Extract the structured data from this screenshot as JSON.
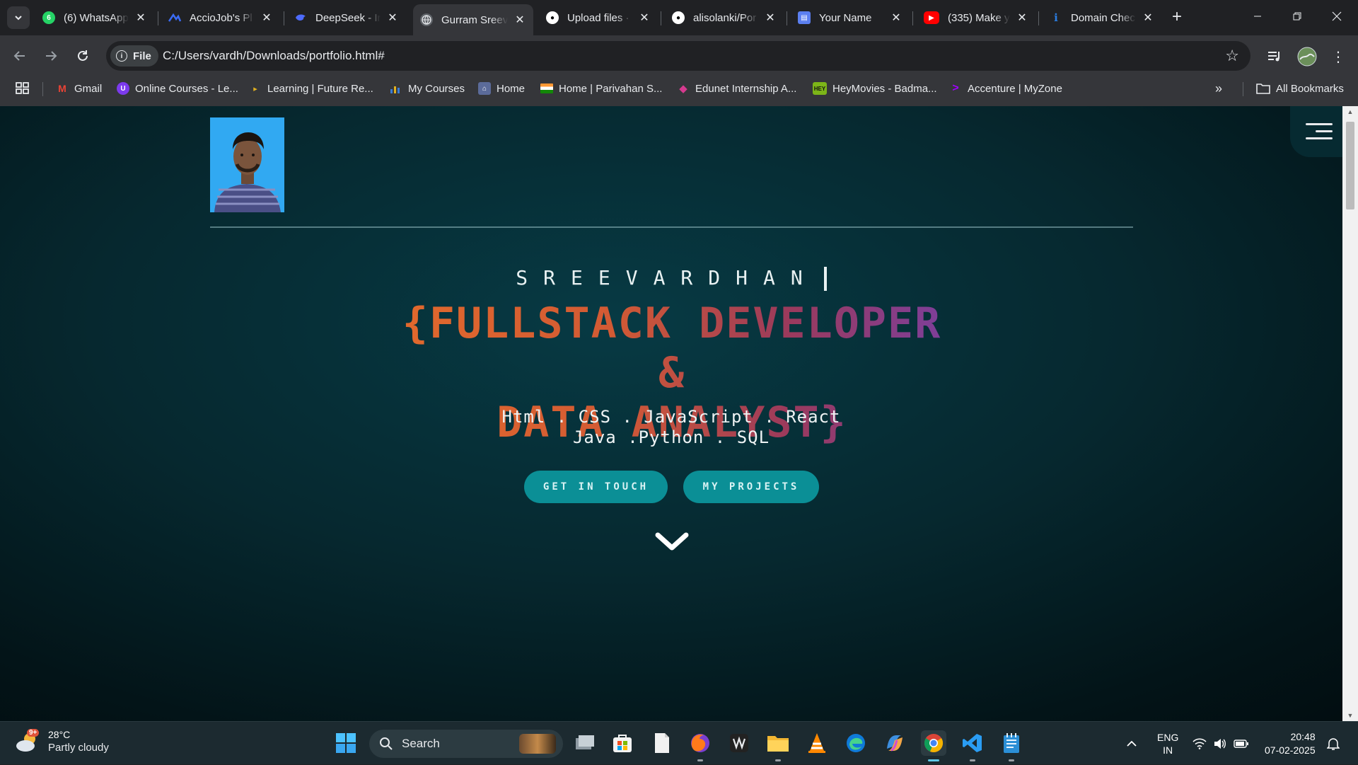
{
  "tabs": [
    {
      "title": "(6) WhatsApp",
      "favicon": "whatsapp-icon",
      "color": "#25d366",
      "badge": "6"
    },
    {
      "title": "AccioJob's Pl",
      "favicon": "acciojob-icon",
      "color": "#3b6cf6"
    },
    {
      "title": "DeepSeek - Ir",
      "favicon": "deepseek-icon",
      "color": "#4d6bfe"
    },
    {
      "title": "Gurram Sreev",
      "favicon": "globe-icon",
      "color": "#9aa0a6",
      "active": true
    },
    {
      "title": "Upload files ·",
      "favicon": "github-icon",
      "color": "#ffffff"
    },
    {
      "title": "alisolanki/Por",
      "favicon": "github-icon",
      "color": "#ffffff"
    },
    {
      "title": "Your Name",
      "favicon": "page-icon",
      "color": "#5b7ff0"
    },
    {
      "title": "(335) Make yo",
      "favicon": "youtube-icon",
      "color": "#ff0000"
    },
    {
      "title": "Domain Chec",
      "favicon": "domain-icon",
      "color": "#2a7de1"
    }
  ],
  "address": {
    "chip": "File",
    "url": "C:/Users/vardh/Downloads/portfolio.html#"
  },
  "bookmarks": [
    {
      "label": "Gmail",
      "icon": "gmail-icon",
      "color": "#ea4335"
    },
    {
      "label": "Online Courses - Le...",
      "icon": "courses-icon",
      "color": "#7c3aed"
    },
    {
      "label": "Learning | Future Re...",
      "icon": "play-icon",
      "color": "#e0b020"
    },
    {
      "label": "My Courses",
      "icon": "chart-icon",
      "color": "#3a7bd5"
    },
    {
      "label": "Home",
      "icon": "building-icon",
      "color": "#5b6b9a"
    },
    {
      "label": "Home | Parivahan S...",
      "icon": "flag-icon",
      "color": "#ff9933"
    },
    {
      "label": "Edunet Internship A...",
      "icon": "edunet-icon",
      "color": "#d63a8f"
    },
    {
      "label": "HeyMovies - Badma...",
      "icon": "hey-icon",
      "color": "#7cb518"
    },
    {
      "label": "Accenture | MyZone",
      "icon": "accenture-icon",
      "color": "#a100ff"
    }
  ],
  "all_bookmarks": "All Bookmarks",
  "page": {
    "name": "SREEVARDHAN",
    "title_line1": "{FULLSTACK DEVELOPER &",
    "title_line2": "DATA ANALYST}",
    "skills_line1": "Html . CSS . JavaScript . React",
    "skills_line2": "Java .Python . SQL",
    "btn_contact": "GET IN TOUCH",
    "btn_projects": "MY PROJECTS"
  },
  "taskbar": {
    "temp": "28°C",
    "condition": "Partly cloudy",
    "weather_badge": "9+",
    "search": "Search",
    "lang1": "ENG",
    "lang2": "IN",
    "time": "20:48",
    "date": "07-02-2025"
  },
  "colors": {
    "accent": "#0b8f96",
    "title_start": "#e26a2c",
    "title_end": "#7a3fa0"
  }
}
